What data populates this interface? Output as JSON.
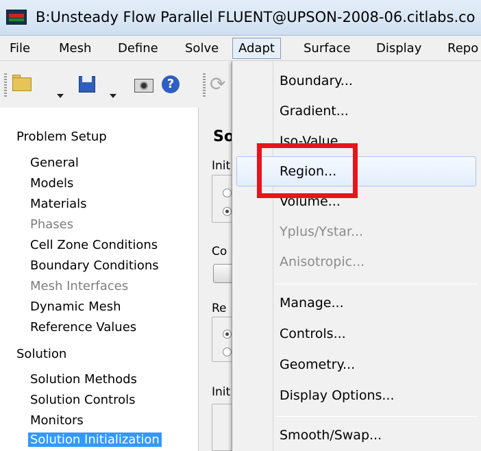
{
  "window": {
    "title": "B:Unsteady Flow Parallel FLUENT@UPSON-2008-06.citlabs.co",
    "icon": "fluent-app-icon"
  },
  "menubar": {
    "items": [
      "File",
      "Mesh",
      "Define",
      "Solve",
      "Adapt",
      "Surface",
      "Display",
      "Repo"
    ],
    "active": "Adapt"
  },
  "toolbar": {
    "icons": [
      "open-folder-icon",
      "save-icon",
      "camera-icon",
      "help-icon",
      "refresh-icon"
    ],
    "help_glyph": "?",
    "refresh_glyph": "⟳"
  },
  "nav": {
    "problem_setup": {
      "heading": "Problem Setup",
      "items": [
        {
          "label": "General",
          "enabled": true
        },
        {
          "label": "Models",
          "enabled": true
        },
        {
          "label": "Materials",
          "enabled": true
        },
        {
          "label": "Phases",
          "enabled": false
        },
        {
          "label": "Cell Zone Conditions",
          "enabled": true
        },
        {
          "label": "Boundary Conditions",
          "enabled": true
        },
        {
          "label": "Mesh Interfaces",
          "enabled": false
        },
        {
          "label": "Dynamic Mesh",
          "enabled": true
        },
        {
          "label": "Reference Values",
          "enabled": true
        }
      ]
    },
    "solution": {
      "heading": "Solution",
      "items": [
        {
          "label": "Solution Methods",
          "enabled": true
        },
        {
          "label": "Solution Controls",
          "enabled": true
        },
        {
          "label": "Monitors",
          "enabled": true
        },
        {
          "label": "Solution Initialization",
          "enabled": true,
          "selected": true
        }
      ]
    }
  },
  "task": {
    "heading": "So",
    "fragments": [
      "Init",
      "Co",
      "Re",
      "Init"
    ]
  },
  "adapt_menu": {
    "items": [
      {
        "label": "Boundary...",
        "enabled": true
      },
      {
        "label": "Gradient...",
        "enabled": true
      },
      {
        "label": "Iso-Value...",
        "enabled": true
      },
      {
        "label": "Region...",
        "enabled": true,
        "highlighted": true
      },
      {
        "label": "Volume...",
        "enabled": true
      },
      {
        "label": "Yplus/Ystar...",
        "enabled": false
      },
      {
        "label": "Anisotropic...",
        "enabled": false
      },
      {
        "label": "Manage...",
        "enabled": true
      },
      {
        "label": "Controls...",
        "enabled": true
      },
      {
        "label": "Geometry...",
        "enabled": true
      },
      {
        "label": "Display Options...",
        "enabled": true
      },
      {
        "label": "Smooth/Swap...",
        "enabled": true
      }
    ]
  },
  "annotation": {
    "color": "#e8141c",
    "target": "Region..."
  },
  "colors": {
    "selection": "#3399ff",
    "disabled_text": "#7d7d7d",
    "annotation_red": "#e8141c"
  }
}
